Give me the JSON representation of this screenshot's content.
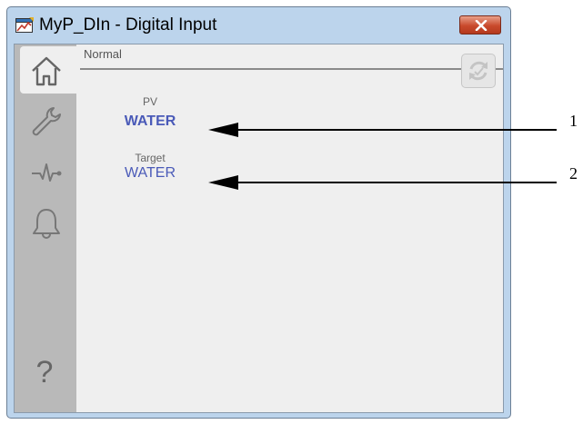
{
  "window": {
    "title": "MyP_DIn - Digital Input",
    "close_label": "close"
  },
  "sidebar": {
    "items": [
      {
        "name": "home"
      },
      {
        "name": "maintenance"
      },
      {
        "name": "trends"
      },
      {
        "name": "alarms"
      }
    ],
    "help_label": "?"
  },
  "main": {
    "status": "Normal",
    "pv_label": "PV",
    "pv_value": "WATER",
    "target_label": "Target",
    "target_value": "WATER"
  },
  "callouts": [
    "1",
    "2"
  ],
  "colors": {
    "value_text": "#4a5ab8",
    "close_button": "#c9492c",
    "sidebar": "#b9b9b9"
  }
}
